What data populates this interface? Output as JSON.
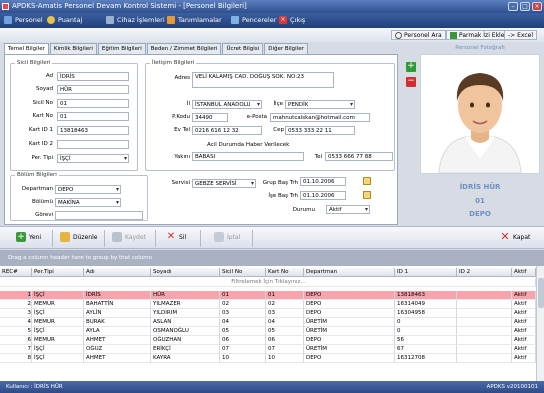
{
  "window": {
    "title": "APDKS-Amatis Personel Devam Kontrol Sistemi - [Personel Bilgileri]"
  },
  "menu": [
    "Personel",
    "Puantaj",
    "Cihaz İşlemleri",
    "Tanımlamalar",
    "Pencereler",
    "Çıkış"
  ],
  "toolbar2": {
    "search": "Personel Ara",
    "fingerprint": "Parmak İzi Ekle",
    "excel": "-> Excel"
  },
  "tabs": [
    "Temel Bilgiler",
    "Kimlik Bilgileri",
    "Eğitim Bilgileri",
    "Beden / Zimmet Bilgileri",
    "Ücret Bilgisi",
    "Diğer Bilgiler"
  ],
  "sicil": {
    "title": "Sicil Bilgileri",
    "labels": {
      "ad": "Ad",
      "soyad": "Soyad",
      "sicil_no": "Sicil No",
      "kart_no": "Kart No",
      "kart_id1": "Kart ID 1",
      "kart_id2": "Kart ID 2",
      "per_tipi": "Per. Tipi"
    },
    "values": {
      "ad": "İDRİS",
      "soyad": "HÜR",
      "sicil_no": "01",
      "kart_no": "01",
      "kart_id1": "13818463",
      "kart_id2": "",
      "per_tipi": "İŞÇİ"
    }
  },
  "bolum": {
    "title": "Bölüm Bilgileri",
    "labels": {
      "departman": "Departman",
      "bolumu": "Bölümü",
      "gorevi": "Görevi"
    },
    "values": {
      "departman": "DEPO",
      "bolumu": "MAKİNA",
      "gorevi": ""
    }
  },
  "iletisim": {
    "title": "İletişim Bilgileri",
    "labels": {
      "adres": "Adres",
      "il": "İl",
      "ilce": "İlçe",
      "pkodu": "P.Kodu",
      "eposta": "e-Posta",
      "evtel": "Ev Tel",
      "cep": "Cep",
      "acil": "Acil Durumda Haber Verilecek",
      "yakini": "Yakını",
      "tel": "Tel"
    },
    "values": {
      "adres": "VELİ KALAMIŞ CAD. DOĞUŞ SOK. NO:23",
      "il": "İSTANBUL ANADOLU",
      "ilce": "PENDİK",
      "pkodu": "34490",
      "eposta": "mahnutcalskan@hotmail.com",
      "evtel": "0216 616 12 32",
      "cep": "0533 333 22 11",
      "yakini": "BABASI",
      "tel": "0533 666 77 88"
    }
  },
  "servis": {
    "labels": {
      "servis": "Servisi",
      "grup_bas": "Grup Baş Trh",
      "ise_bas": "İşe Baş Trh",
      "durumu": "Durumu"
    },
    "values": {
      "servis": "GEBZE SERVİSİ",
      "grup_bas": "01.10.2006",
      "ise_bas": "01.10.2006",
      "durumu": "Aktif"
    }
  },
  "photo": {
    "title": "Personel Fotoğrafı",
    "name": "İDRİS HÜR",
    "sicil": "01",
    "dept": "DEPO"
  },
  "actions": {
    "yeni": "Yeni",
    "duzenle": "Düzenle",
    "kaydet": "Kaydet",
    "sil": "Sil",
    "iptal": "İptal",
    "kapat": "Kapat"
  },
  "grid": {
    "group_hint": "Drag a column header here to group by that column",
    "filter_hint": "Filtrelemek İçin Tıklayınız...",
    "columns": [
      "REC#",
      "Per.Tipi",
      "Adı",
      "Soyadı",
      "Sicil No",
      "Kart No",
      "Departman",
      "ID 1",
      "ID 2",
      "Aktif"
    ],
    "rows": [
      [
        "1",
        "İŞÇİ",
        "İDRİS",
        "HÜR",
        "01",
        "01",
        "DEPO",
        "13818463",
        "",
        "Aktif"
      ],
      [
        "2",
        "MEMUR",
        "BAHATTİN",
        "YILMAZER",
        "02",
        "02",
        "DEPO",
        "16314049",
        "",
        "Aktif"
      ],
      [
        "3",
        "İŞÇİ",
        "AYLİN",
        "YILDIRIM",
        "03",
        "03",
        "DEPO",
        "16304958",
        "",
        "Aktif"
      ],
      [
        "4",
        "MEMUR",
        "BURAK",
        "ASLAN",
        "04",
        "04",
        "ÜRETİM",
        "0",
        "",
        "Aktif"
      ],
      [
        "5",
        "İŞÇİ",
        "AYLA",
        "OSMANOĞLU",
        "05",
        "05",
        "ÜRETİM",
        "0",
        "",
        "Aktif"
      ],
      [
        "6",
        "MEMUR",
        "AHMET",
        "OĞUZHAN",
        "06",
        "06",
        "DEPO",
        "56",
        "",
        "Aktif"
      ],
      [
        "7",
        "İŞÇİ",
        "OĞUZ",
        "ERİKÇİ",
        "07",
        "07",
        "ÜRETİM",
        "67",
        "",
        "Aktif"
      ],
      [
        "8",
        "İŞÇİ",
        "AHMET",
        "KAYRA",
        "10",
        "10",
        "DEPO",
        "16312708",
        "",
        "Aktif"
      ]
    ]
  },
  "status": {
    "user": "Kullanıcı : İDRİS HÜR",
    "version": "APDKS v20100101"
  },
  "colors": {
    "accent": "#2f4f8f",
    "selected_row": "#f9a3ad",
    "photo_text": "#6d8fc4"
  }
}
